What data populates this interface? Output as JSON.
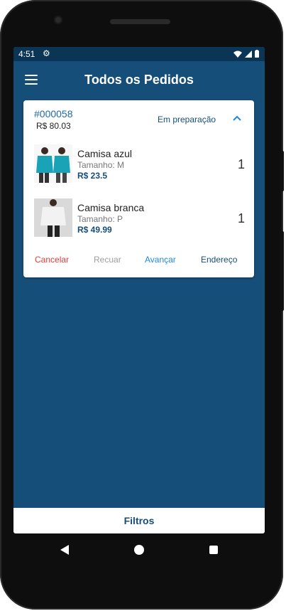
{
  "status_bar": {
    "time": "4:51"
  },
  "app_bar": {
    "title": "Todos os Pedidos"
  },
  "order": {
    "id": "#000058",
    "total": "R$ 80.03",
    "status": "Em preparação",
    "items": [
      {
        "name": "Camisa azul",
        "size": "Tamanho: M",
        "price": "R$ 23.5",
        "quantity": "1",
        "shirt_color": "#1aa3b6"
      },
      {
        "name": "Camisa branca",
        "size": "Tamanho: P",
        "price": "R$ 49.99",
        "quantity": "1",
        "shirt_color": "#f2f2f2"
      }
    ],
    "actions": {
      "cancel": "Cancelar",
      "back": "Recuar",
      "forward": "Avançar",
      "address": "Endereço"
    }
  },
  "filters_label": "Filtros",
  "colors": {
    "primary": "#164e7a",
    "statusbar": "#0b3555",
    "cancel": "#e53935",
    "forward": "#1e88e5",
    "disabled": "#9e9e9e"
  }
}
